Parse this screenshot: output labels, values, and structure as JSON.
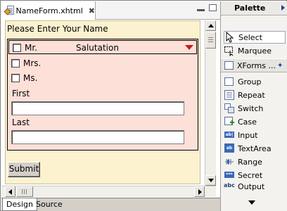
{
  "editor": {
    "tab_label": "NameForm.xhtml",
    "close_glyph": "✖"
  },
  "form": {
    "title": "Please Enter Your Name",
    "select": {
      "label": "Salutation",
      "options": [
        "Mr.",
        "Mrs.",
        "Ms."
      ]
    },
    "first_label": "First",
    "last_label": "Last",
    "first_value": "",
    "last_value": "",
    "submit_label": "Submit"
  },
  "bottom_tabs": [
    "Design",
    "Source"
  ],
  "palette": {
    "title": "Palette",
    "tools": [
      {
        "label": "Select",
        "icon": "pointer-icon"
      },
      {
        "label": "Marquee",
        "icon": "marquee-icon"
      }
    ],
    "drawer": {
      "label": "XForms ...",
      "icon": "xforms-icon"
    },
    "items": [
      {
        "label": "Group",
        "icon": "group-icon"
      },
      {
        "label": "Repeat",
        "icon": "repeat-icon"
      },
      {
        "label": "Switch",
        "icon": "switch-icon"
      },
      {
        "label": "Case",
        "icon": "case-icon"
      },
      {
        "label": "Input",
        "icon": "input-icon"
      },
      {
        "label": "TextArea",
        "icon": "textarea-icon"
      },
      {
        "label": "Range",
        "icon": "range-icon"
      },
      {
        "label": "Secret",
        "icon": "secret-icon"
      },
      {
        "label": "Output",
        "icon": "output-icon"
      }
    ]
  },
  "colors": {
    "form_background": "#fdf2cf",
    "group_background": "#fde0d8",
    "accent": "#3a68b8"
  }
}
